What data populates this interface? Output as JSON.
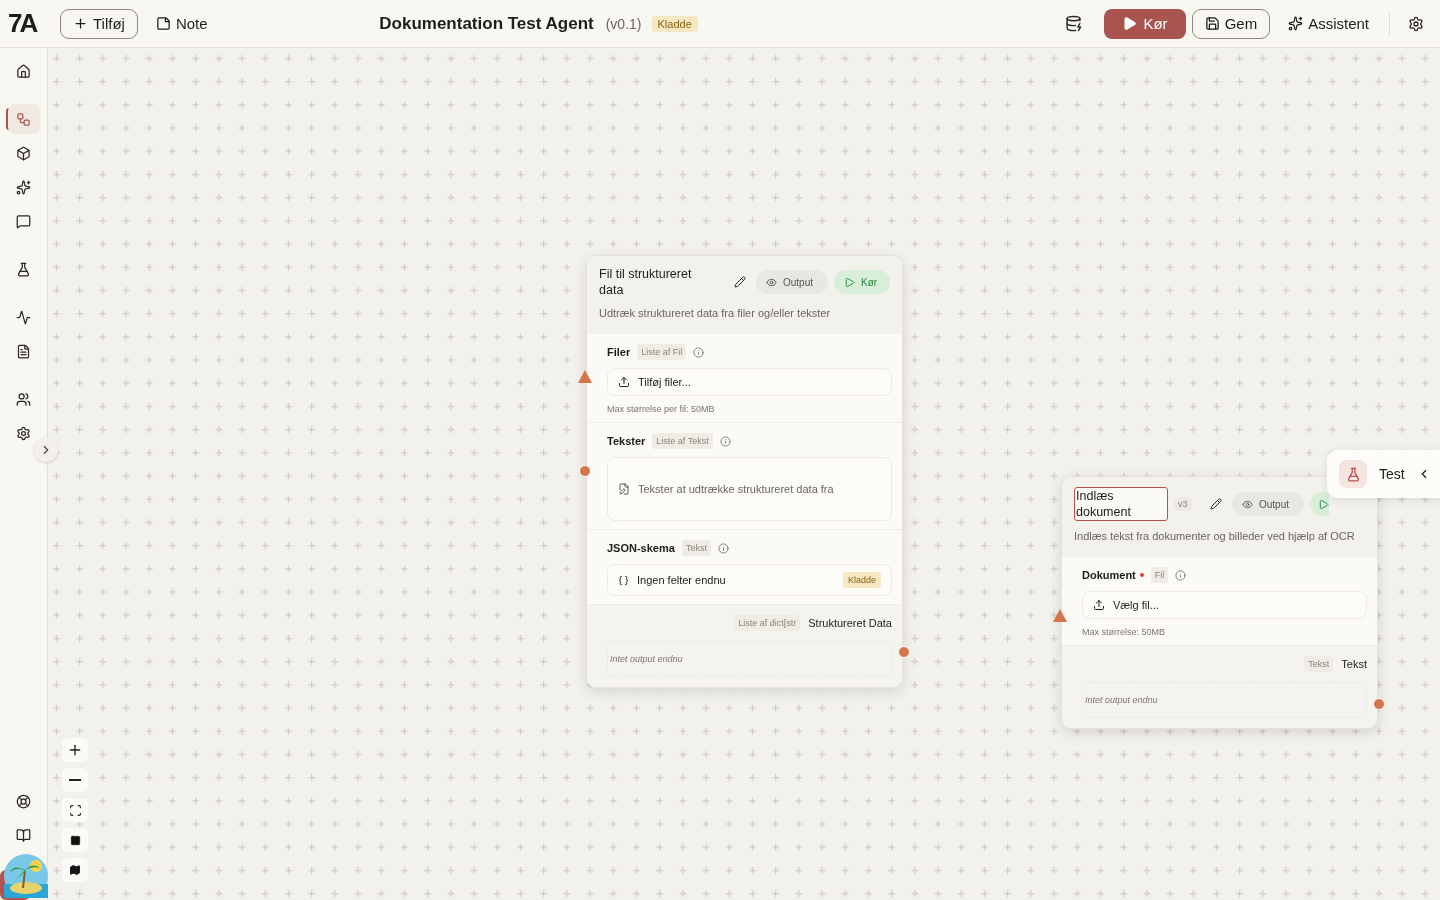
{
  "toolbar": {
    "logo": "7A",
    "add_label": "Tilføj",
    "note_label": "Note",
    "title": "Dokumentation Test Agent",
    "version": "(v0.1)",
    "status": "Kladde",
    "run_label": "Kør",
    "save_label": "Gem",
    "assistant_label": "Assistent"
  },
  "sidebar": {
    "items": [
      {
        "selected": false
      },
      {
        "selected": true
      },
      {
        "selected": false
      },
      {
        "selected": false
      },
      {
        "selected": false
      },
      {
        "selected": false
      },
      {
        "selected": false
      },
      {
        "selected": false
      },
      {
        "selected": false
      },
      {
        "selected": false
      }
    ]
  },
  "nodes": [
    {
      "title": "Fil til struktureret data",
      "editing": false,
      "description": "Udtræk struktureret data fra filer og/eller tekster",
      "output_label": "Output",
      "run_label": "Kør",
      "inputs": [
        {
          "kind": "upload",
          "label": "Filer",
          "required": false,
          "type": "Liste af Fil",
          "button": "Tilføj filer...",
          "hint": "Max størrelse per fil: 50MB"
        },
        {
          "kind": "text",
          "label": "Tekster",
          "required": false,
          "type": "Liste af Tekst",
          "placeholder": "Tekster at udtrække struktureret data fra"
        },
        {
          "kind": "schema",
          "label": "JSON-skema",
          "required": false,
          "type": "Tekst",
          "text": "Ingen felter endnu",
          "badge": "Kladde"
        }
      ],
      "output": {
        "type": "Liste af dict[str",
        "label": "Struktureret Data",
        "empty": "Intet output endnu"
      }
    },
    {
      "title": "Indlæs dokument",
      "editing": true,
      "version": "v3",
      "description": "Indlæs tekst fra dokumenter og billeder ved hjælp af OCR",
      "output_label": "Output",
      "inputs": [
        {
          "kind": "upload",
          "label": "Dokument",
          "required": true,
          "type": "Fil",
          "button": "Vælg fil...",
          "hint": "Max størrelse: 50MB"
        }
      ],
      "output": {
        "type": "Tekst",
        "label": "Tekst",
        "empty": "Intet output endnu"
      }
    }
  ],
  "test_panel": {
    "label": "Test"
  }
}
